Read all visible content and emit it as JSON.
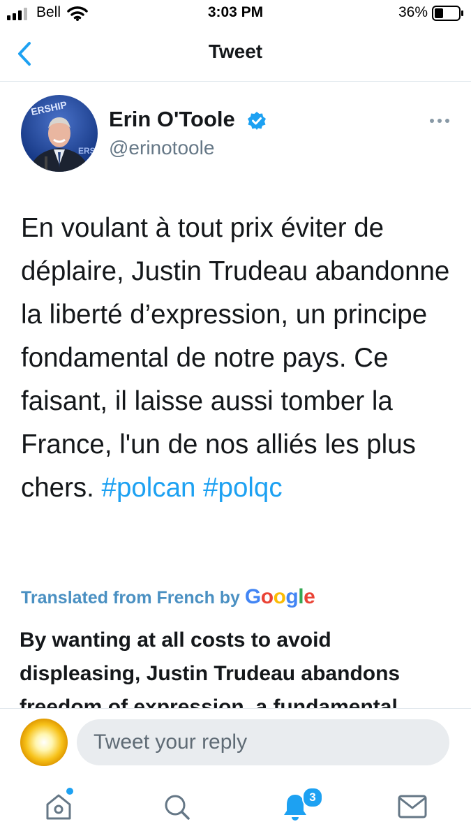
{
  "status_bar": {
    "carrier": "Bell",
    "time": "3:03 PM",
    "battery": "36%"
  },
  "nav": {
    "title": "Tweet",
    "back_icon": "chevron-left-icon"
  },
  "tweet": {
    "author_name": "Erin O'Toole",
    "author_handle": "@erinotoole",
    "verified_icon": "verified-badge-icon",
    "more_icon": "more-horizontal-icon",
    "text_before_tags": "En voulant à tout prix éviter de déplaire, Justin Trudeau abandonne la liberté d’expression, un principe fondamental de notre pays. Ce faisant, il laisse aussi tomber la France, l'un de nos alliés les plus chers.",
    "hashtags": [
      "#polcan",
      "#polqc"
    ],
    "translated_label": "Translated from French by",
    "google_logo": "Google",
    "translation": "By wanting at all costs to avoid displeasing, Justin Trudeau abandons freedom of expression, a fundamental principle of our country."
  },
  "reply": {
    "placeholder": "Tweet your reply",
    "avatar_icon": "sun-avatar-icon"
  },
  "tabs": [
    {
      "icon": "home-icon",
      "has_dot": true
    },
    {
      "icon": "search-icon"
    },
    {
      "icon": "notifications-bell-icon",
      "badge": "3"
    },
    {
      "icon": "messages-envelope-icon"
    }
  ],
  "colors": {
    "accent": "#1da1f2",
    "text": "#14171a",
    "secondary": "#657786",
    "input_bg": "#e9ecef"
  }
}
